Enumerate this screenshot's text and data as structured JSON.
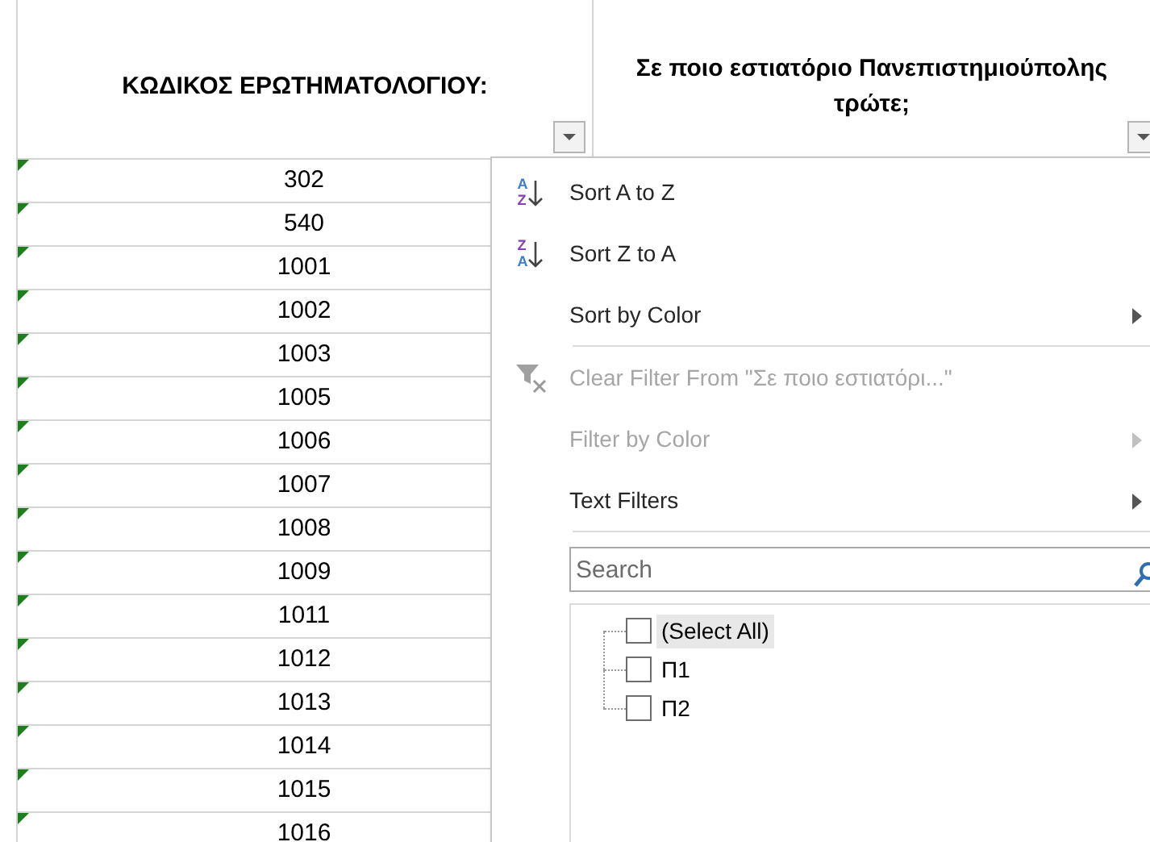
{
  "columns": [
    {
      "header": "ΚΩΔΙΚΟΣ ΕΡΩΤΗΜΑΤΟΛΟΓΙΟΥ:"
    },
    {
      "header": "Σε ποιο εστιατόριο Πανεπιστημιούπολης τρώτε;"
    }
  ],
  "rows": [
    "302",
    "540",
    "1001",
    "1002",
    "1003",
    "1005",
    "1006",
    "1007",
    "1008",
    "1009",
    "1011",
    "1012",
    "1013",
    "1014",
    "1015",
    "1016"
  ],
  "filter_menu": {
    "items": [
      {
        "kind": "sort",
        "icon_letters": [
          "A",
          "Z"
        ],
        "label": "Sort A to Z",
        "disabled": false,
        "submenu": false
      },
      {
        "kind": "sort",
        "icon_letters": [
          "Z",
          "A"
        ],
        "label": "Sort Z to A",
        "disabled": false,
        "submenu": false
      },
      {
        "kind": "item",
        "label": "Sort by Color",
        "disabled": false,
        "submenu": true
      },
      {
        "kind": "separator"
      },
      {
        "kind": "clear",
        "label": "Clear Filter From \"Σε ποιο εστιατόρι...\"",
        "disabled": true,
        "submenu": false
      },
      {
        "kind": "item",
        "label": "Filter by Color",
        "disabled": true,
        "submenu": true
      },
      {
        "kind": "item",
        "label": "Text Filters",
        "disabled": false,
        "submenu": true
      },
      {
        "kind": "separator"
      }
    ],
    "search": {
      "placeholder": "Search"
    },
    "values": [
      {
        "label": "(Select All)",
        "checked": false,
        "highlighted": true
      },
      {
        "label": "Π1",
        "checked": false,
        "highlighted": false
      },
      {
        "label": "Π2",
        "checked": false,
        "highlighted": false
      }
    ]
  }
}
